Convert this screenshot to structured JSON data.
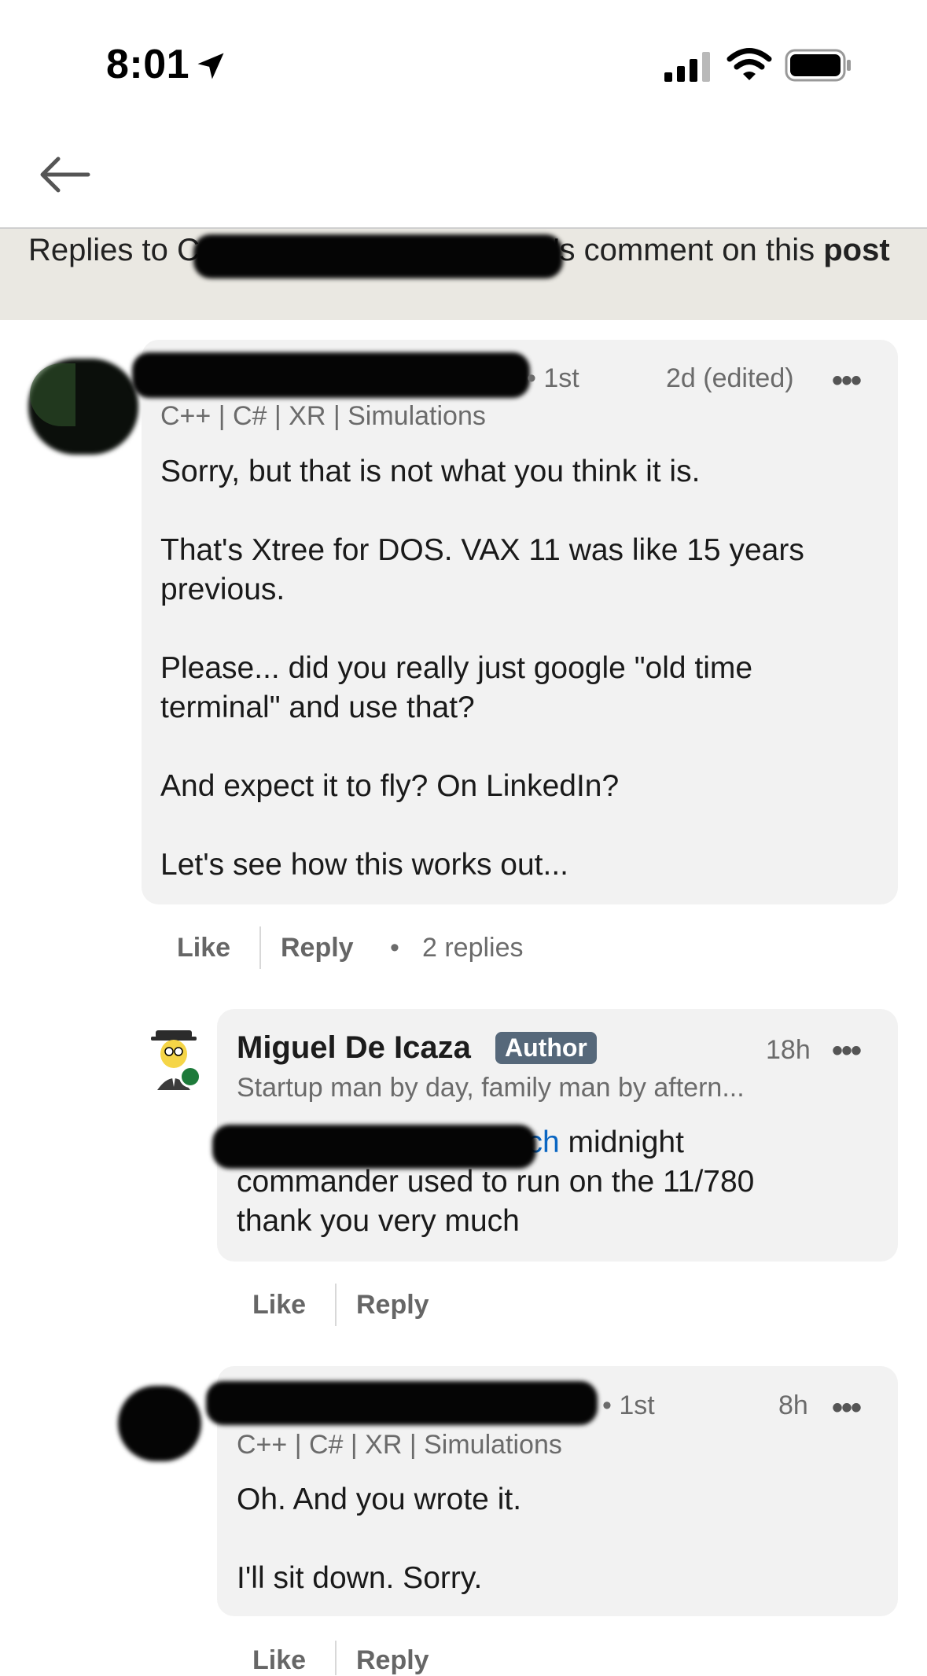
{
  "status_bar": {
    "time": "8:01"
  },
  "banner": {
    "prefix": "Replies to C",
    "suffix": "'s comment on this ",
    "post_word": "post"
  },
  "comments": [
    {
      "degree": "• 1st",
      "time": "2d (edited)",
      "menu": "•••",
      "headline": "C++ | C# | XR | Simulations",
      "paragraphs": [
        "Sorry, but that is not what you think it is.",
        "That's Xtree for DOS. VAX 11 was like 15 years",
        "previous.",
        "Please... did you really just google \"old time",
        "terminal\" and use that?",
        "And expect it to fly? On LinkedIn?",
        "Let's see how this works out..."
      ],
      "like": "Like",
      "reply": "Reply",
      "replies_count": "2 replies"
    },
    {
      "name": "Miguel De Icaza",
      "badge": "Author",
      "time": "18h",
      "menu": "•••",
      "headline": "Startup man by day, family man by aftern...",
      "mention_tail": "sch",
      "lines": [
        "midnight",
        "commander used to run on the 11/780",
        "thank you very much"
      ],
      "like": "Like",
      "reply": "Reply"
    },
    {
      "degree": "• 1st",
      "time": "8h",
      "menu": "•••",
      "headline": "C++ | C# | XR | Simulations",
      "paragraphs": [
        "Oh. And you wrote it.",
        "I'll sit down. Sorry."
      ],
      "like": "Like",
      "reply": "Reply"
    }
  ],
  "colors": {
    "banner_bg": "#eae8e2",
    "bubble_bg": "#f2f2f2",
    "badge_bg": "#56687a",
    "link": "#0a66c2"
  }
}
